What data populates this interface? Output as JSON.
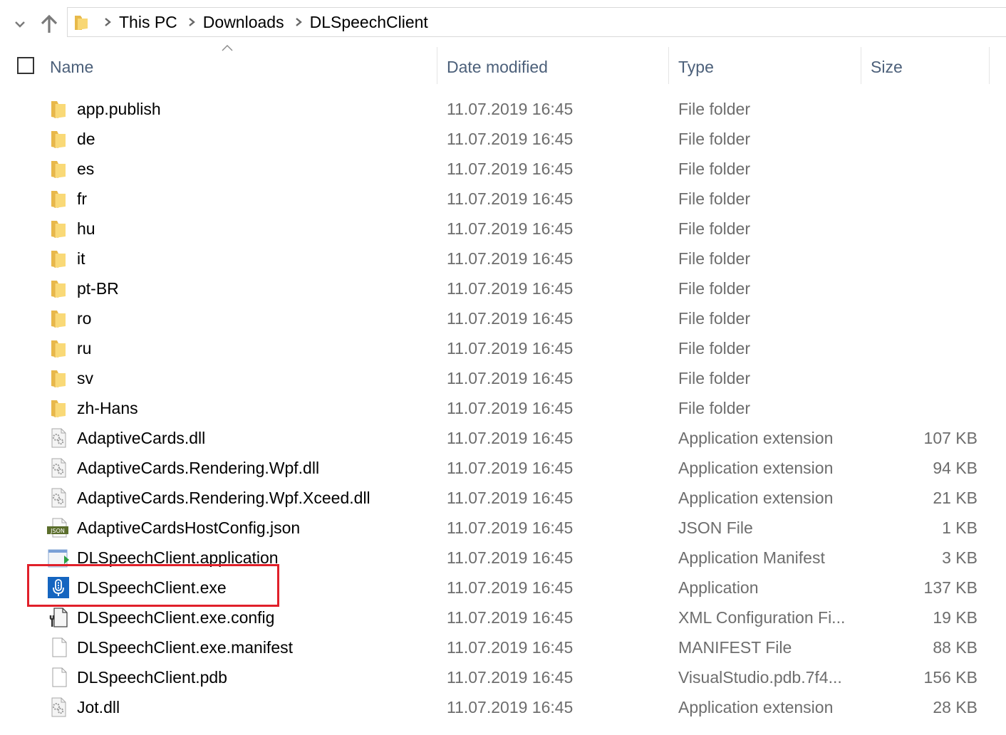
{
  "navigation": {
    "recent_dropdown_icon": "chevron-down-icon",
    "up_icon": "arrow-up-icon",
    "address_icon": "folder-icon",
    "breadcrumbs": [
      "This PC",
      "Downloads",
      "DLSpeechClient"
    ]
  },
  "header": {
    "sort_indicator": "sort-ascending-icon",
    "columns": {
      "name": "Name",
      "date": "Date modified",
      "type": "Type",
      "size": "Size"
    }
  },
  "files": [
    {
      "name": "app.publish",
      "date": "11.07.2019 16:45",
      "type": "File folder",
      "size": "",
      "icon": "folder"
    },
    {
      "name": "de",
      "date": "11.07.2019 16:45",
      "type": "File folder",
      "size": "",
      "icon": "folder"
    },
    {
      "name": "es",
      "date": "11.07.2019 16:45",
      "type": "File folder",
      "size": "",
      "icon": "folder"
    },
    {
      "name": "fr",
      "date": "11.07.2019 16:45",
      "type": "File folder",
      "size": "",
      "icon": "folder"
    },
    {
      "name": "hu",
      "date": "11.07.2019 16:45",
      "type": "File folder",
      "size": "",
      "icon": "folder"
    },
    {
      "name": "it",
      "date": "11.07.2019 16:45",
      "type": "File folder",
      "size": "",
      "icon": "folder"
    },
    {
      "name": "pt-BR",
      "date": "11.07.2019 16:45",
      "type": "File folder",
      "size": "",
      "icon": "folder"
    },
    {
      "name": "ro",
      "date": "11.07.2019 16:45",
      "type": "File folder",
      "size": "",
      "icon": "folder"
    },
    {
      "name": "ru",
      "date": "11.07.2019 16:45",
      "type": "File folder",
      "size": "",
      "icon": "folder"
    },
    {
      "name": "sv",
      "date": "11.07.2019 16:45",
      "type": "File folder",
      "size": "",
      "icon": "folder"
    },
    {
      "name": "zh-Hans",
      "date": "11.07.2019 16:45",
      "type": "File folder",
      "size": "",
      "icon": "folder"
    },
    {
      "name": "AdaptiveCards.dll",
      "date": "11.07.2019 16:45",
      "type": "Application extension",
      "size": "107 KB",
      "icon": "dll"
    },
    {
      "name": "AdaptiveCards.Rendering.Wpf.dll",
      "date": "11.07.2019 16:45",
      "type": "Application extension",
      "size": "94 KB",
      "icon": "dll"
    },
    {
      "name": "AdaptiveCards.Rendering.Wpf.Xceed.dll",
      "date": "11.07.2019 16:45",
      "type": "Application extension",
      "size": "21 KB",
      "icon": "dll"
    },
    {
      "name": "AdaptiveCardsHostConfig.json",
      "date": "11.07.2019 16:45",
      "type": "JSON File",
      "size": "1 KB",
      "icon": "json"
    },
    {
      "name": "DLSpeechClient.application",
      "date": "11.07.2019 16:45",
      "type": "Application Manifest",
      "size": "3 KB",
      "icon": "application"
    },
    {
      "name": "DLSpeechClient.exe",
      "date": "11.07.2019 16:45",
      "type": "Application",
      "size": "137 KB",
      "icon": "exe"
    },
    {
      "name": "DLSpeechClient.exe.config",
      "date": "11.07.2019 16:45",
      "type": "XML Configuration Fi...",
      "size": "19 KB",
      "icon": "config"
    },
    {
      "name": "DLSpeechClient.exe.manifest",
      "date": "11.07.2019 16:45",
      "type": "MANIFEST File",
      "size": "88 KB",
      "icon": "blank"
    },
    {
      "name": "DLSpeechClient.pdb",
      "date": "11.07.2019 16:45",
      "type": "VisualStudio.pdb.7f4...",
      "size": "156 KB",
      "icon": "blank"
    },
    {
      "name": "Jot.dll",
      "date": "11.07.2019 16:45",
      "type": "Application extension",
      "size": "28 KB",
      "icon": "dll"
    }
  ],
  "json_icon_label": "JSON",
  "highlighted_file": "DLSpeechClient.exe",
  "colors": {
    "highlight_border": "#e0202a",
    "header_text": "#4c607a",
    "detail_text": "#6d6d6d",
    "folder_yellow": "#f5cf6a",
    "exe_blue": "#1565c0"
  }
}
